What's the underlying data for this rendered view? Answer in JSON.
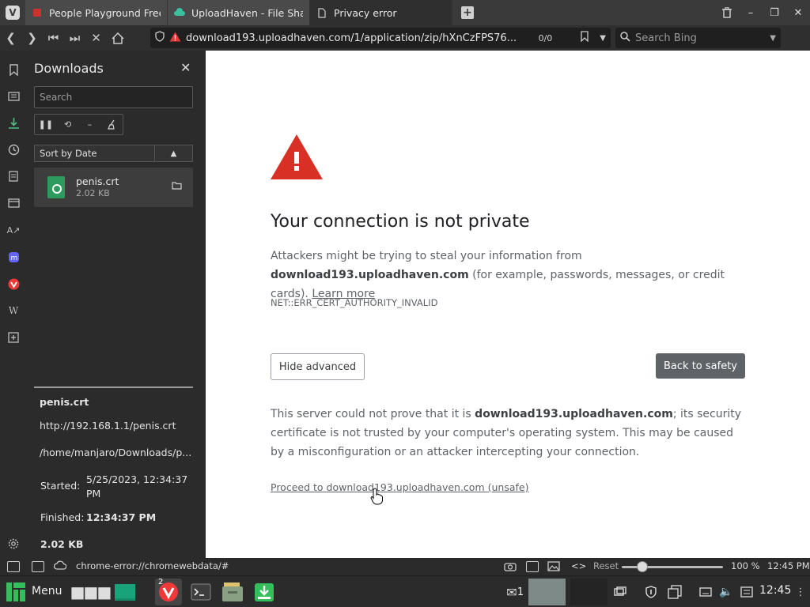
{
  "tabs": [
    {
      "title": "People Playground Free Do",
      "favicon": "red-app-icon",
      "active": false
    },
    {
      "title": "UploadHaven - File Sharing",
      "favicon": "cloud-icon",
      "active": false
    },
    {
      "title": "Privacy error",
      "favicon": "document-icon",
      "active": true
    }
  ],
  "address": {
    "url": "download193.uploadhaven.com/1/application/zip/hXnCzFPS76...",
    "find_count": "0/0",
    "search_placeholder": "Search Bing"
  },
  "downloads": {
    "title": "Downloads",
    "search_placeholder": "Search",
    "sort_label": "Sort by Date",
    "items": [
      {
        "name": "penis.crt",
        "size": "2.02 KB"
      }
    ],
    "detail": {
      "name": "penis.crt",
      "source_url": "http://192.168.1.1/penis.crt",
      "path": "/home/manjaro/Downloads/p...",
      "started_label": "Started:",
      "started_value": "5/25/2023, 12:34:37 PM",
      "finished_label": "Finished:",
      "finished_value": "12:34:37 PM",
      "size": "2.02 KB"
    }
  },
  "page": {
    "headline": "Your connection is not private",
    "para1_pre": "Attackers might be trying to steal your information from ",
    "para1_host": "download193.uploadhaven.com",
    "para1_post": " (for example, passwords, messages, or credit cards). ",
    "learn_more": "Learn more",
    "error_code": "NET::ERR_CERT_AUTHORITY_INVALID",
    "hide_advanced": "Hide advanced",
    "back_to_safety": "Back to safety",
    "para2_pre": "This server could not prove that it is ",
    "para2_host": "download193.uploadhaven.com",
    "para2_post": "; its security certificate is not trusted by your computer's operating system. This may be caused by a misconfiguration or an attacker intercepting your connection.",
    "proceed_link": "Proceed to download193.uploadhaven.com (unsafe)"
  },
  "statusbar": {
    "status_url": "chrome-error://chromewebdata/#",
    "reset_label": "Reset",
    "zoom": "100 %",
    "zoom_level_percent": 100,
    "time": "12:45 PM"
  },
  "taskbar": {
    "menu_label": "Menu",
    "vivaldi_windows": "2",
    "notification_count": "1",
    "clock": "12:45"
  },
  "colors": {
    "warning_red": "#d93025",
    "download_green": "#2e9b5e",
    "accent_green": "#4cbf84"
  }
}
